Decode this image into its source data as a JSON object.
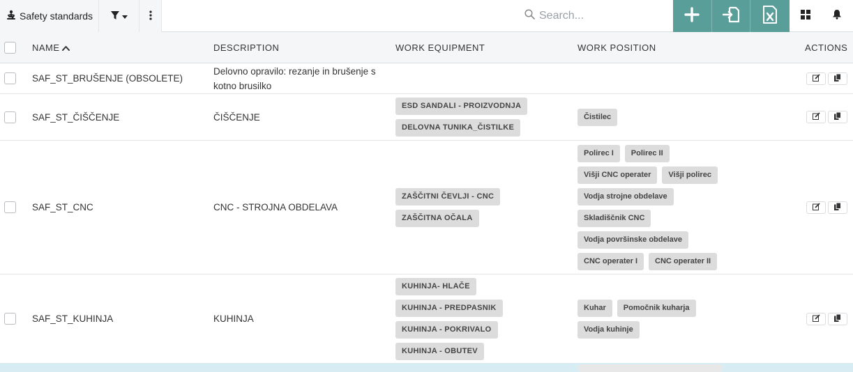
{
  "toolbar": {
    "title": "Safety standards",
    "search_placeholder": "Search..."
  },
  "table": {
    "headers": {
      "name": "NAME",
      "description": "DESCRIPTION",
      "work_equipment": "WORK EQUIPMENT",
      "work_position": "WORK POSITION",
      "actions": "ACTIONS"
    },
    "rows": [
      {
        "name": "SAF_ST_BRUŠENJE (OBSOLETE)",
        "description": "Delovno opravilo: rezanje in brušenje s kotno brusilko",
        "equipment": [],
        "positions": []
      },
      {
        "name": "SAF_ST_ČIŠČENJE",
        "description": "ČIŠČENJE",
        "equipment": [
          "ESD SANDALI - PROIZVODNJA",
          "DELOVNA TUNIKA_ČISTILKE"
        ],
        "positions": [
          "Čistilec"
        ]
      },
      {
        "name": "SAF_ST_CNC",
        "description": "CNC - STROJNA OBDELAVA",
        "equipment": [
          "ZAŠČITNI ČEVLJI - CNC",
          "ZAŠČITNA OČALA"
        ],
        "positions": [
          "Polirec I",
          "Polirec II",
          "Višji CNC operater",
          "Višji polirec",
          "Vodja strojne obdelave",
          "Skladiščnik CNC",
          "Vodja površinske obdelave",
          "CNC operater I",
          "CNC operater II"
        ]
      },
      {
        "name": "SAF_ST_KUHINJA",
        "description": "KUHINJA",
        "equipment": [
          "KUHINJA- HLAČE",
          "KUHINJA - PREDPASNIK",
          "KUHINJA - POKRIVALO",
          "KUHINJA - OBUTEV"
        ],
        "positions": [
          "Kuhar",
          "Pomočnik kuharja",
          "Vodja kuhinje"
        ]
      }
    ]
  },
  "colors": {
    "accent": "#5a9e99",
    "tag_bg": "#dcdcdc",
    "header_bg": "#f5f6f7"
  },
  "icons": {
    "title": "person-safety-icon",
    "filter": "filter-icon",
    "more": "more-vertical-icon",
    "search": "search-icon",
    "add": "plus-icon",
    "import": "import-icon",
    "excel": "excel-icon",
    "grid": "grid-icon",
    "bell": "bell-icon",
    "edit": "edit-icon",
    "copy": "copy-icon"
  }
}
